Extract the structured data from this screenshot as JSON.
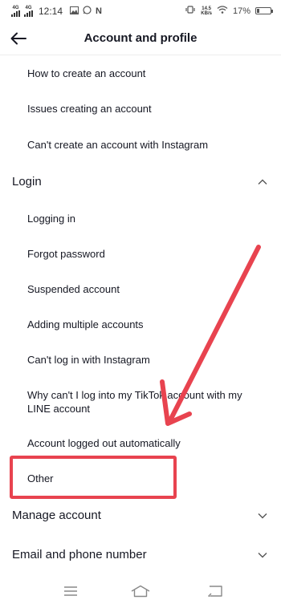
{
  "status_bar": {
    "sim1": "4G",
    "sim2": "4G",
    "time": "12:14",
    "app_letter": "N",
    "speed_top": "14.5",
    "speed_bottom": "KB/s",
    "battery_pct": "17%",
    "battery_level": 0.17
  },
  "header": {
    "title": "Account and profile"
  },
  "top_items": [
    "How to create an account",
    "Issues creating an account",
    "Can't create an account with Instagram"
  ],
  "login_section": {
    "label": "Login",
    "expanded": true,
    "items": [
      "Logging in",
      "Forgot password",
      "Suspended account",
      "Adding multiple accounts",
      "Can't log in with Instagram",
      "Why can't I log into my TikTok account with my LINE account",
      "Account logged out automatically",
      "Other"
    ]
  },
  "sections": [
    {
      "label": "Manage account",
      "expanded": false
    },
    {
      "label": "Email and phone number",
      "expanded": false
    }
  ],
  "annotation": {
    "color": "#e8434f"
  }
}
